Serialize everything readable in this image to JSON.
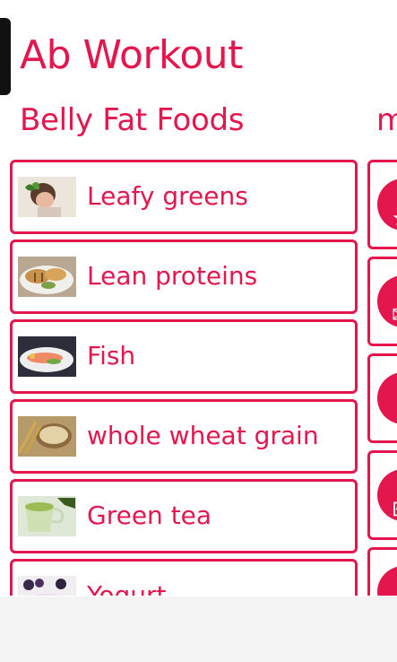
{
  "app": {
    "title": "Ab Workout"
  },
  "section": {
    "title": "Belly Fat Foods",
    "next_title_fragment": "m"
  },
  "items": [
    {
      "label": "Leafy greens"
    },
    {
      "label": "Lean proteins"
    },
    {
      "label": "Fish"
    },
    {
      "label": "whole wheat grain"
    },
    {
      "label": "Green tea"
    },
    {
      "label": "Yogurt"
    }
  ],
  "side_tiles": [
    {
      "icon": "star-icon"
    },
    {
      "icon": "mail-icon"
    },
    {
      "icon": "circle-icon"
    },
    {
      "icon": "gift-icon"
    },
    {
      "icon": "share-icon"
    }
  ],
  "colors": {
    "accent": "#e3174d",
    "background": "#ffffff",
    "bottom_bar": "#f4f4f4"
  }
}
